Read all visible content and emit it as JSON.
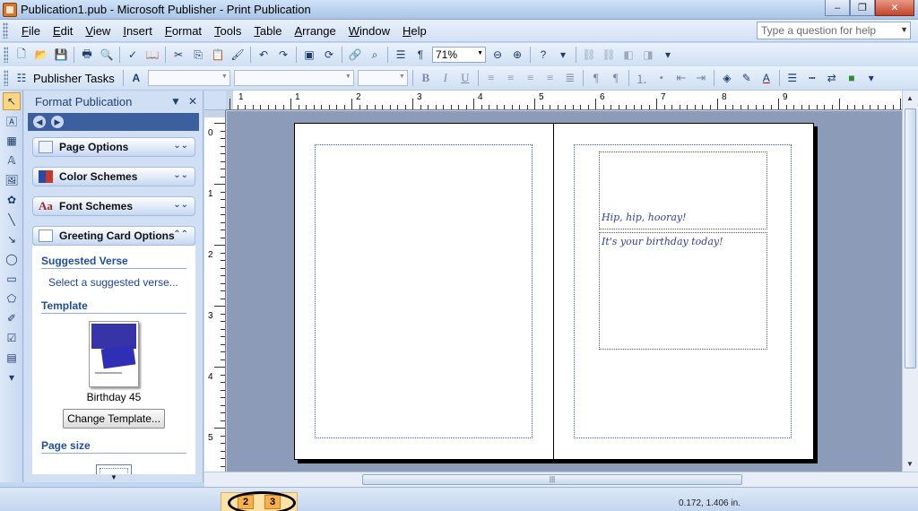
{
  "window": {
    "title": "Publication1.pub - Microsoft Publisher - Print Publication",
    "minimize": "‒",
    "maximize": "❐",
    "close": "✕"
  },
  "menu": {
    "items": [
      "File",
      "Edit",
      "View",
      "Insert",
      "Format",
      "Tools",
      "Table",
      "Arrange",
      "Window",
      "Help"
    ],
    "help_placeholder": "Type a question for help"
  },
  "toolbar": {
    "zoom": "71%",
    "publisher_tasks": "Publisher Tasks"
  },
  "taskpane": {
    "title": "Format Publication",
    "sections": [
      {
        "label": "Page Options"
      },
      {
        "label": "Color Schemes"
      },
      {
        "label": "Font Schemes"
      },
      {
        "label": "Greeting Card Options"
      }
    ],
    "suggested_verse_title": "Suggested Verse",
    "suggested_verse_link": "Select a suggested verse...",
    "template_title": "Template",
    "template_name": "Birthday 45",
    "change_template": "Change Template...",
    "page_size_title": "Page size"
  },
  "rulers": {
    "h_labels": [
      "1",
      "1",
      "2",
      "3",
      "4",
      "5",
      "6",
      "7",
      "8",
      "9"
    ],
    "v_labels": [
      "0",
      "1",
      "2",
      "3",
      "4",
      "5"
    ]
  },
  "document": {
    "verse_line1": "Hip, hip, hooray!",
    "verse_line2": "It's your birthday today!"
  },
  "status": {
    "pages": [
      "2",
      "3"
    ],
    "coordinates": "0.172, 1.406 in."
  }
}
